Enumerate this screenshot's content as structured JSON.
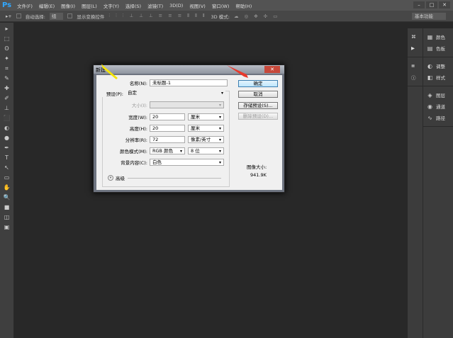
{
  "app": {
    "logo": "Ps"
  },
  "menu": [
    "文件(F)",
    "编辑(E)",
    "图像(I)",
    "图层(L)",
    "文字(Y)",
    "选择(S)",
    "滤镜(T)",
    "3D(D)",
    "视图(V)",
    "窗口(W)",
    "帮助(H)"
  ],
  "window_buttons": {
    "minimize": "–",
    "maximize": "□",
    "close": "✕"
  },
  "options": {
    "auto_select_label": "自动选择:",
    "auto_select_value": "组",
    "show_transform": "显示变换控件",
    "mode_3d": "3D 模式:",
    "workspace": "基本功能"
  },
  "panels": {
    "col1": [
      "⌘",
      "▶",
      "≣",
      "ⓘ"
    ],
    "items": [
      {
        "icon": "▦",
        "label": "颜色"
      },
      {
        "icon": "▤",
        "label": "色板"
      },
      {
        "icon": "◐",
        "label": "调整"
      },
      {
        "icon": "◧",
        "label": "样式"
      },
      {
        "icon": "◈",
        "label": "图层"
      },
      {
        "icon": "◉",
        "label": "通道"
      },
      {
        "icon": "∿",
        "label": "路径"
      }
    ]
  },
  "tools": [
    "▸",
    "⬚",
    "ʘ",
    "✦",
    "⌗",
    "✎",
    "✚",
    "✐",
    "⊥",
    "⬛",
    "◐",
    "●",
    "✒",
    "T",
    "↖",
    "▭",
    "✋",
    "🔍",
    "■",
    "◫",
    "▣"
  ],
  "dialog": {
    "title": "新建",
    "close": "✕",
    "name_label": "名称(N):",
    "name_value": "未标题-1",
    "preset_label": "预设(P):",
    "preset_value": "自定",
    "size_label": "大小(I):",
    "width_label": "宽度(W):",
    "width_value": "20",
    "width_unit": "厘米",
    "height_label": "高度(H):",
    "height_value": "20",
    "height_unit": "厘米",
    "resolution_label": "分辨率(R):",
    "resolution_value": "72",
    "resolution_unit": "像素/英寸",
    "color_mode_label": "颜色模式(M):",
    "color_mode_value": "RGB 颜色",
    "bit_depth": "8 位",
    "background_label": "背景内容(C):",
    "background_value": "白色",
    "advanced_label": "高级",
    "ok": "确定",
    "cancel": "取消",
    "save_preset": "存储预设(S)...",
    "delete_preset": "删除预设(D)...",
    "image_size_label": "图像大小:",
    "image_size_value": "941.9K"
  }
}
